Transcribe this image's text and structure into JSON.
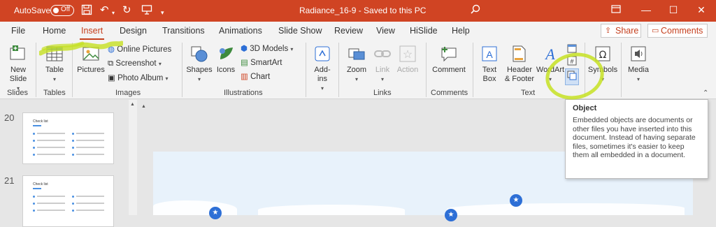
{
  "titlebar": {
    "autosave_label": "AutoSave",
    "autosave_state": "Off",
    "document_title": "Radiance_16-9  -  Saved to this PC",
    "accent": "#d04423"
  },
  "tabs": [
    {
      "label": "File"
    },
    {
      "label": "Home"
    },
    {
      "label": "Insert"
    },
    {
      "label": "Design"
    },
    {
      "label": "Transitions"
    },
    {
      "label": "Animations"
    },
    {
      "label": "Slide Show"
    },
    {
      "label": "Review"
    },
    {
      "label": "View"
    },
    {
      "label": "HiSlide"
    },
    {
      "label": "Help"
    }
  ],
  "share_label": "Share",
  "comments_label": "Comments",
  "ribbon": {
    "new_slide": "New Slide",
    "table": "Table",
    "pictures": "Pictures",
    "online_pictures": "Online Pictures",
    "screenshot": "Screenshot",
    "photo_album": "Photo Album",
    "shapes": "Shapes",
    "icons": "Icons",
    "models_3d": "3D Models",
    "smartart": "SmartArt",
    "chart": "Chart",
    "addins": "Add-ins",
    "zoom": "Zoom",
    "link": "Link",
    "action": "Action",
    "comment": "Comment",
    "text_box": "Text Box",
    "header_footer": "Header & Footer",
    "wordart": "WordArt",
    "symbols": "Symbols",
    "media": "Media",
    "groups": {
      "slides": "Slides",
      "tables": "Tables",
      "images": "Images",
      "illustrations": "Illustrations",
      "links": "Links",
      "comments": "Comments",
      "text": "Text"
    }
  },
  "thumbnails": [
    {
      "number": "20",
      "title": "Check list"
    },
    {
      "number": "21",
      "title": "Check list"
    }
  ],
  "tooltip": {
    "title": "Object",
    "body": "Embedded objects are documents or other files you have inserted into this document. Instead of having separate files, sometimes it's easier to keep them all embedded in a document."
  },
  "icons": [
    "autosave-toggle",
    "save-icon",
    "undo-icon",
    "redo-icon",
    "present-icon",
    "search-icon",
    "ribbon-display-icon",
    "minimize-icon",
    "maximize-icon",
    "close-icon"
  ],
  "colors": {
    "highlight": "#c5e022",
    "tab_active": "#c43e1c",
    "pin": "#2d6fd6"
  }
}
